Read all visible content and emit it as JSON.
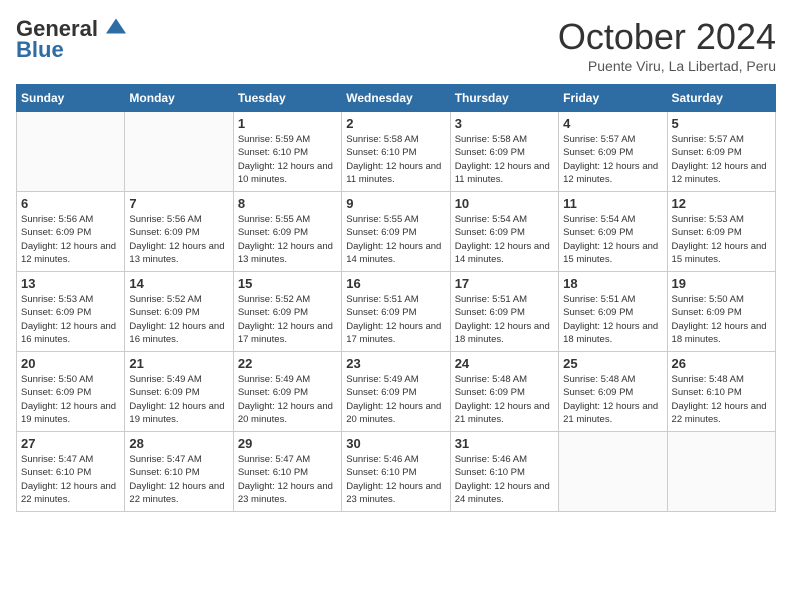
{
  "header": {
    "logo_line1": "General",
    "logo_line2": "Blue",
    "month_title": "October 2024",
    "subtitle": "Puente Viru, La Libertad, Peru"
  },
  "weekdays": [
    "Sunday",
    "Monday",
    "Tuesday",
    "Wednesday",
    "Thursday",
    "Friday",
    "Saturday"
  ],
  "weeks": [
    [
      {
        "day": "",
        "info": ""
      },
      {
        "day": "",
        "info": ""
      },
      {
        "day": "1",
        "info": "Sunrise: 5:59 AM\nSunset: 6:10 PM\nDaylight: 12 hours and 10 minutes."
      },
      {
        "day": "2",
        "info": "Sunrise: 5:58 AM\nSunset: 6:10 PM\nDaylight: 12 hours and 11 minutes."
      },
      {
        "day": "3",
        "info": "Sunrise: 5:58 AM\nSunset: 6:09 PM\nDaylight: 12 hours and 11 minutes."
      },
      {
        "day": "4",
        "info": "Sunrise: 5:57 AM\nSunset: 6:09 PM\nDaylight: 12 hours and 12 minutes."
      },
      {
        "day": "5",
        "info": "Sunrise: 5:57 AM\nSunset: 6:09 PM\nDaylight: 12 hours and 12 minutes."
      }
    ],
    [
      {
        "day": "6",
        "info": "Sunrise: 5:56 AM\nSunset: 6:09 PM\nDaylight: 12 hours and 12 minutes."
      },
      {
        "day": "7",
        "info": "Sunrise: 5:56 AM\nSunset: 6:09 PM\nDaylight: 12 hours and 13 minutes."
      },
      {
        "day": "8",
        "info": "Sunrise: 5:55 AM\nSunset: 6:09 PM\nDaylight: 12 hours and 13 minutes."
      },
      {
        "day": "9",
        "info": "Sunrise: 5:55 AM\nSunset: 6:09 PM\nDaylight: 12 hours and 14 minutes."
      },
      {
        "day": "10",
        "info": "Sunrise: 5:54 AM\nSunset: 6:09 PM\nDaylight: 12 hours and 14 minutes."
      },
      {
        "day": "11",
        "info": "Sunrise: 5:54 AM\nSunset: 6:09 PM\nDaylight: 12 hours and 15 minutes."
      },
      {
        "day": "12",
        "info": "Sunrise: 5:53 AM\nSunset: 6:09 PM\nDaylight: 12 hours and 15 minutes."
      }
    ],
    [
      {
        "day": "13",
        "info": "Sunrise: 5:53 AM\nSunset: 6:09 PM\nDaylight: 12 hours and 16 minutes."
      },
      {
        "day": "14",
        "info": "Sunrise: 5:52 AM\nSunset: 6:09 PM\nDaylight: 12 hours and 16 minutes."
      },
      {
        "day": "15",
        "info": "Sunrise: 5:52 AM\nSunset: 6:09 PM\nDaylight: 12 hours and 17 minutes."
      },
      {
        "day": "16",
        "info": "Sunrise: 5:51 AM\nSunset: 6:09 PM\nDaylight: 12 hours and 17 minutes."
      },
      {
        "day": "17",
        "info": "Sunrise: 5:51 AM\nSunset: 6:09 PM\nDaylight: 12 hours and 18 minutes."
      },
      {
        "day": "18",
        "info": "Sunrise: 5:51 AM\nSunset: 6:09 PM\nDaylight: 12 hours and 18 minutes."
      },
      {
        "day": "19",
        "info": "Sunrise: 5:50 AM\nSunset: 6:09 PM\nDaylight: 12 hours and 18 minutes."
      }
    ],
    [
      {
        "day": "20",
        "info": "Sunrise: 5:50 AM\nSunset: 6:09 PM\nDaylight: 12 hours and 19 minutes."
      },
      {
        "day": "21",
        "info": "Sunrise: 5:49 AM\nSunset: 6:09 PM\nDaylight: 12 hours and 19 minutes."
      },
      {
        "day": "22",
        "info": "Sunrise: 5:49 AM\nSunset: 6:09 PM\nDaylight: 12 hours and 20 minutes."
      },
      {
        "day": "23",
        "info": "Sunrise: 5:49 AM\nSunset: 6:09 PM\nDaylight: 12 hours and 20 minutes."
      },
      {
        "day": "24",
        "info": "Sunrise: 5:48 AM\nSunset: 6:09 PM\nDaylight: 12 hours and 21 minutes."
      },
      {
        "day": "25",
        "info": "Sunrise: 5:48 AM\nSunset: 6:09 PM\nDaylight: 12 hours and 21 minutes."
      },
      {
        "day": "26",
        "info": "Sunrise: 5:48 AM\nSunset: 6:10 PM\nDaylight: 12 hours and 22 minutes."
      }
    ],
    [
      {
        "day": "27",
        "info": "Sunrise: 5:47 AM\nSunset: 6:10 PM\nDaylight: 12 hours and 22 minutes."
      },
      {
        "day": "28",
        "info": "Sunrise: 5:47 AM\nSunset: 6:10 PM\nDaylight: 12 hours and 22 minutes."
      },
      {
        "day": "29",
        "info": "Sunrise: 5:47 AM\nSunset: 6:10 PM\nDaylight: 12 hours and 23 minutes."
      },
      {
        "day": "30",
        "info": "Sunrise: 5:46 AM\nSunset: 6:10 PM\nDaylight: 12 hours and 23 minutes."
      },
      {
        "day": "31",
        "info": "Sunrise: 5:46 AM\nSunset: 6:10 PM\nDaylight: 12 hours and 24 minutes."
      },
      {
        "day": "",
        "info": ""
      },
      {
        "day": "",
        "info": ""
      }
    ]
  ]
}
